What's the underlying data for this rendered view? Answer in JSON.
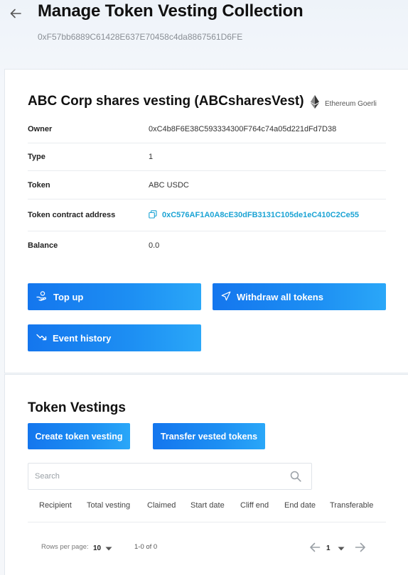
{
  "header": {
    "title": "Manage Token Vesting Collection",
    "address": "0xF57bb6889C61428E637E70458c4da8867561D6FE"
  },
  "collection": {
    "name": "ABC Corp shares vesting (ABCsharesVest)",
    "network": "Ethereum Goerli",
    "rows": [
      {
        "label": "Owner",
        "value": "0xC4b8F6E38C593334300F764c74a05d221dFd7D38"
      },
      {
        "label": "Type",
        "value": "1"
      },
      {
        "label": "Token",
        "value": "ABC USDC"
      },
      {
        "label": "Token contract address",
        "value": "0xC576AF1A0A8cE30dFB3131C105de1eC410C2Ce55"
      },
      {
        "label": "Balance",
        "value": "0.0"
      }
    ],
    "buttons": {
      "top_up": "Top up",
      "withdraw_all": "Withdraw all tokens",
      "event_history": "Event history"
    }
  },
  "vestings": {
    "title": "Token Vestings",
    "create_label": "Create token vesting",
    "transfer_label": "Transfer vested tokens",
    "search_placeholder": "Search",
    "columns": [
      "Recipient",
      "Total vesting",
      "Claimed",
      "Start date",
      "Cliff end",
      "End date",
      "Transferable"
    ],
    "pagination": {
      "rows_per_page_label": "Rows per page:",
      "rows_per_page": "10",
      "range": "1-0 of 0",
      "page": "1"
    }
  },
  "colors": {
    "accent": "#1d8ff3",
    "link": "#1aa3d4"
  }
}
